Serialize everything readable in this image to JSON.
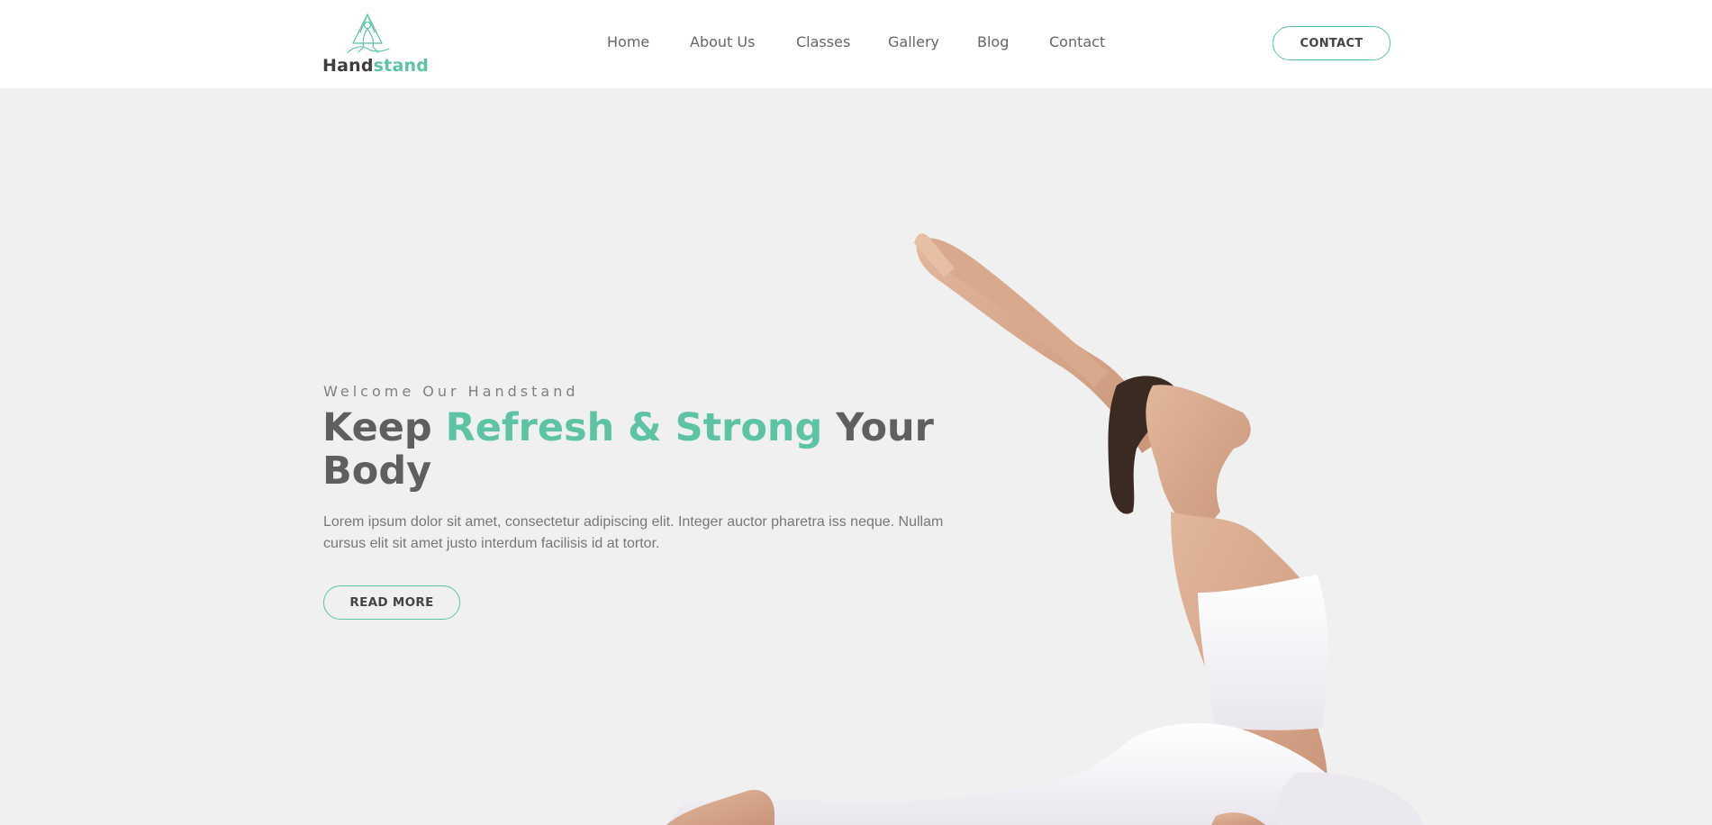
{
  "brand": {
    "name_part1": "Hand",
    "name_part2": "stand",
    "logo_icon": "yoga-pose-icon",
    "accent_color": "#5cc4a4"
  },
  "nav": {
    "items": [
      {
        "label": "Home"
      },
      {
        "label": "About Us"
      },
      {
        "label": "Classes"
      },
      {
        "label": "Gallery"
      },
      {
        "label": "Blog"
      },
      {
        "label": "Contact"
      }
    ],
    "contact_button": "CONTACT"
  },
  "hero": {
    "welcome": "Welcome Our Handstand",
    "headline_part1": "Keep ",
    "headline_accent": "Refresh & Strong",
    "headline_part2": " Your Body",
    "description": "Lorem ipsum dolor sit amet, consectetur adipiscing elit. Integer auctor pharetra iss neque. Nullam cursus elit sit amet justo interdum facilisis id at tortor.",
    "read_more": "READ MORE",
    "image": "yoga-woman-stretching-photo"
  },
  "colors": {
    "accent": "#5cc4a4",
    "text_dark": "#5f5f5f",
    "background": "#f0f0f0"
  }
}
